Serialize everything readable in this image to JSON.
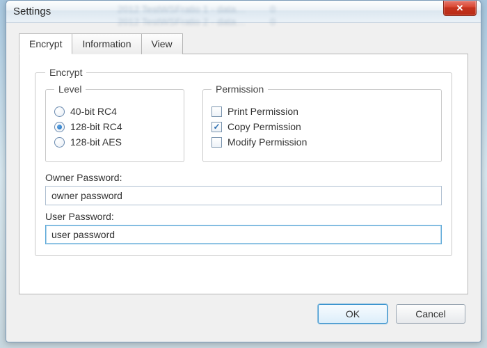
{
  "window": {
    "title": "Settings",
    "close_glyph": "✕"
  },
  "tabs": [
    {
      "label": "Encrypt",
      "active": true
    },
    {
      "label": "Information",
      "active": false
    },
    {
      "label": "View",
      "active": false
    }
  ],
  "encrypt": {
    "group_label": "Encrypt",
    "level": {
      "group_label": "Level",
      "options": [
        {
          "label": "40-bit RC4",
          "checked": false
        },
        {
          "label": "128-bit RC4",
          "checked": true
        },
        {
          "label": "128-bit AES",
          "checked": false
        }
      ]
    },
    "permission": {
      "group_label": "Permission",
      "options": [
        {
          "label": "Print Permission",
          "checked": false
        },
        {
          "label": "Copy Permission",
          "checked": true
        },
        {
          "label": "Modify Permission",
          "checked": false
        }
      ]
    },
    "owner_password": {
      "label": "Owner Password:",
      "value": "owner password"
    },
    "user_password": {
      "label": "User Password:",
      "value": "user password"
    }
  },
  "buttons": {
    "ok": "OK",
    "cancel": "Cancel"
  }
}
